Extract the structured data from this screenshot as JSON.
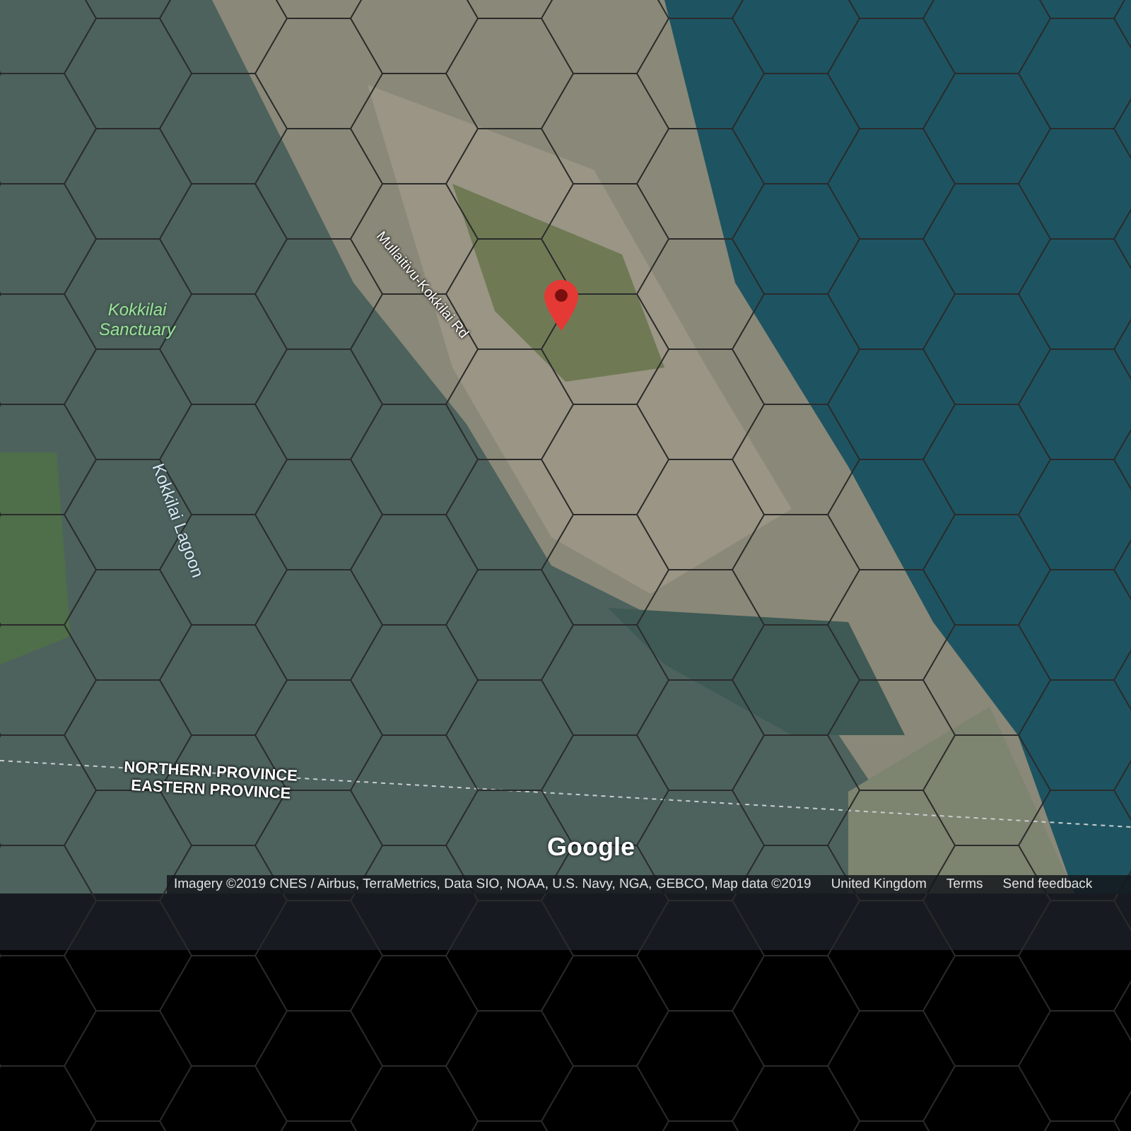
{
  "map": {
    "labels": [
      {
        "kind": "place",
        "text": "Kokkilai\nSanctuary"
      },
      {
        "kind": "water",
        "text": "Kokkilai Lagoon"
      },
      {
        "kind": "road",
        "text": "Mullaitivu-Kokkilai Rd"
      },
      {
        "kind": "boundary",
        "text": "NORTHERN PROVINCE"
      },
      {
        "kind": "boundary",
        "text": "EASTERN PROVINCE"
      }
    ],
    "logo": "Google"
  },
  "attribution": {
    "text": "Imagery ©2019 CNES / Airbus, TerraMetrics, Data SIO, NOAA, U.S. Navy, NGA, GEBCO, Map data ©2019",
    "links": [
      "United Kingdom",
      "Terms",
      "Send feedback"
    ]
  }
}
